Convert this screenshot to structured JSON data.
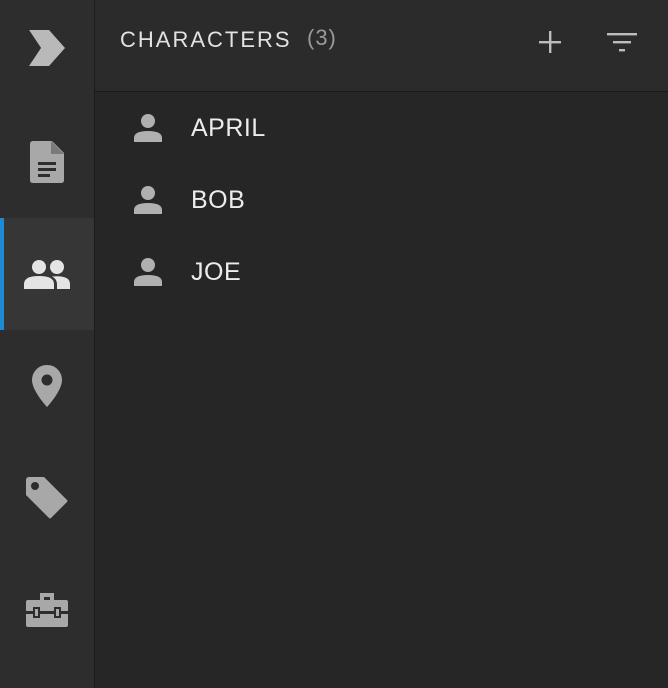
{
  "sidebar": {
    "logo": "app-logo",
    "items": [
      {
        "icon": "document-icon",
        "active": false
      },
      {
        "icon": "people-icon",
        "active": true
      },
      {
        "icon": "location-pin-icon",
        "active": false
      },
      {
        "icon": "tag-icon",
        "active": false
      },
      {
        "icon": "toolbox-icon",
        "active": false
      }
    ]
  },
  "header": {
    "title": "CHARACTERS",
    "count": "(3)",
    "add_icon": "plus-icon",
    "filter_icon": "filter-icon"
  },
  "characters": [
    {
      "name": "APRIL"
    },
    {
      "name": "BOB"
    },
    {
      "name": "JOE"
    }
  ],
  "colors": {
    "accent": "#1e8ad6",
    "rail_bg": "#2d2d2d",
    "panel_bg": "#262626",
    "icon": "#a8a8a8"
  }
}
